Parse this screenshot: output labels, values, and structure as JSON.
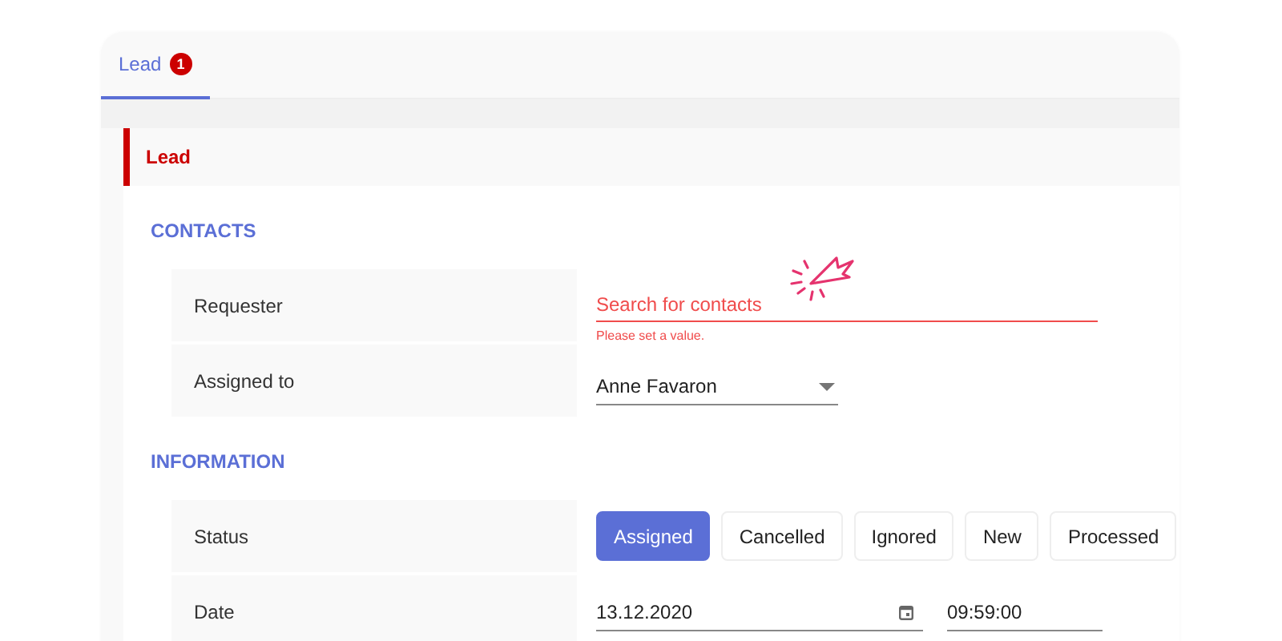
{
  "tabs": [
    {
      "label": "Lead",
      "badge": "1",
      "selected": true
    }
  ],
  "section": {
    "title": "Lead"
  },
  "groups": [
    {
      "title": "CONTACTS",
      "rows": [
        {
          "kind": "search",
          "label": "Requester",
          "placeholder": "Search for contacts",
          "error": "Please set a value."
        },
        {
          "kind": "select",
          "label": "Assigned to",
          "value": "Anne Favaron"
        }
      ]
    },
    {
      "title": "INFORMATION",
      "rows": [
        {
          "kind": "choices",
          "label": "Status",
          "options": [
            {
              "label": "Assigned",
              "selected": true
            },
            {
              "label": "Cancelled",
              "selected": false
            },
            {
              "label": "Ignored",
              "selected": false
            },
            {
              "label": "New",
              "selected": false
            },
            {
              "label": "Processed",
              "selected": false
            }
          ]
        },
        {
          "kind": "datetime",
          "label": "Date",
          "date": "13.12.2020",
          "time": "09:59:00"
        }
      ]
    }
  ]
}
